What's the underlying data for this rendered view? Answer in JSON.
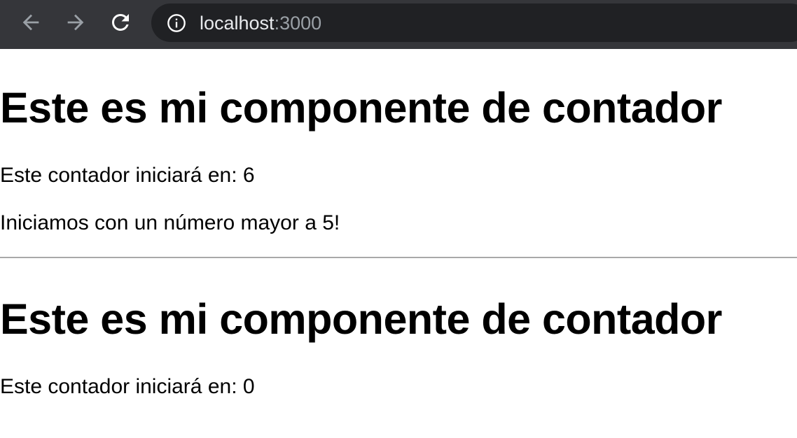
{
  "browser": {
    "url_host": "localhost",
    "url_port": ":3000",
    "icons": {
      "back": "arrow-left-icon",
      "forward": "arrow-right-icon",
      "reload": "reload-icon",
      "site_info": "info-circle-icon"
    },
    "colors": {
      "toolbar": "#35363a",
      "omnibox": "#202124",
      "url_host": "#e8eaed",
      "url_port": "#9aa0a6",
      "nav_disabled": "#9aa0a6"
    }
  },
  "page": {
    "counters": [
      {
        "heading": "Este es mi componente de contador",
        "start_text": "Este contador iniciará en: 6",
        "note": "Iniciamos con un número mayor a 5!"
      },
      {
        "heading": "Este es mi componente de contador",
        "start_text": "Este contador iniciará en: 0"
      }
    ]
  }
}
